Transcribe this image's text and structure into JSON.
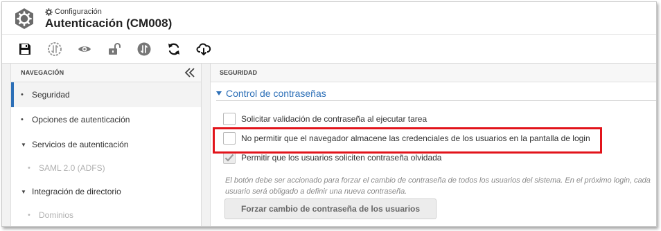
{
  "header": {
    "breadcrumb": "Configuración",
    "title": "Autenticación (CM008)"
  },
  "toolbar": {
    "buttons": [
      {
        "icon": "save-icon"
      },
      {
        "icon": "sync-circle-icon"
      },
      {
        "icon": "eye-icon"
      },
      {
        "icon": "unlock-icon"
      },
      {
        "icon": "sort-circle-icon"
      },
      {
        "icon": "refresh-icon"
      },
      {
        "icon": "cloud-download-icon"
      }
    ]
  },
  "sidebar": {
    "header": "NAVEGACIÓN",
    "items": [
      {
        "label": "Seguridad",
        "marker": "•",
        "active": true
      },
      {
        "label": "Opciones de autenticación",
        "marker": "•"
      },
      {
        "label": "Servicios de autenticación",
        "marker": "▼"
      },
      {
        "label": "SAML 2.0 (ADFS)",
        "marker": "•",
        "sub": true
      },
      {
        "label": "Integración de directorio",
        "marker": "▼"
      },
      {
        "label": "Dominios",
        "marker": "•",
        "sub": true
      }
    ]
  },
  "main": {
    "header": "SEGURIDAD",
    "section_title": "Control de contraseñas",
    "options": [
      {
        "label": "Solicitar validación de contraseña al ejecutar tarea",
        "checked": false
      },
      {
        "label": "No permitir que el navegador almacene las credenciales de los usuarios en la pantalla de login",
        "checked": false
      },
      {
        "label": "Permitir que los usuarios soliciten contraseña olvidada",
        "checked": true
      }
    ],
    "help_text": "El botón debe ser accionado para forzar el cambio de contraseña de todos los usuarios del sistema. En el próximo login, cada usuario será obligado a definir una nueva contraseña.",
    "force_button": "Forzar cambio de contraseña de los usuarios"
  },
  "colors": {
    "accent": "#2c6fb7",
    "highlight": "#e2141b"
  }
}
